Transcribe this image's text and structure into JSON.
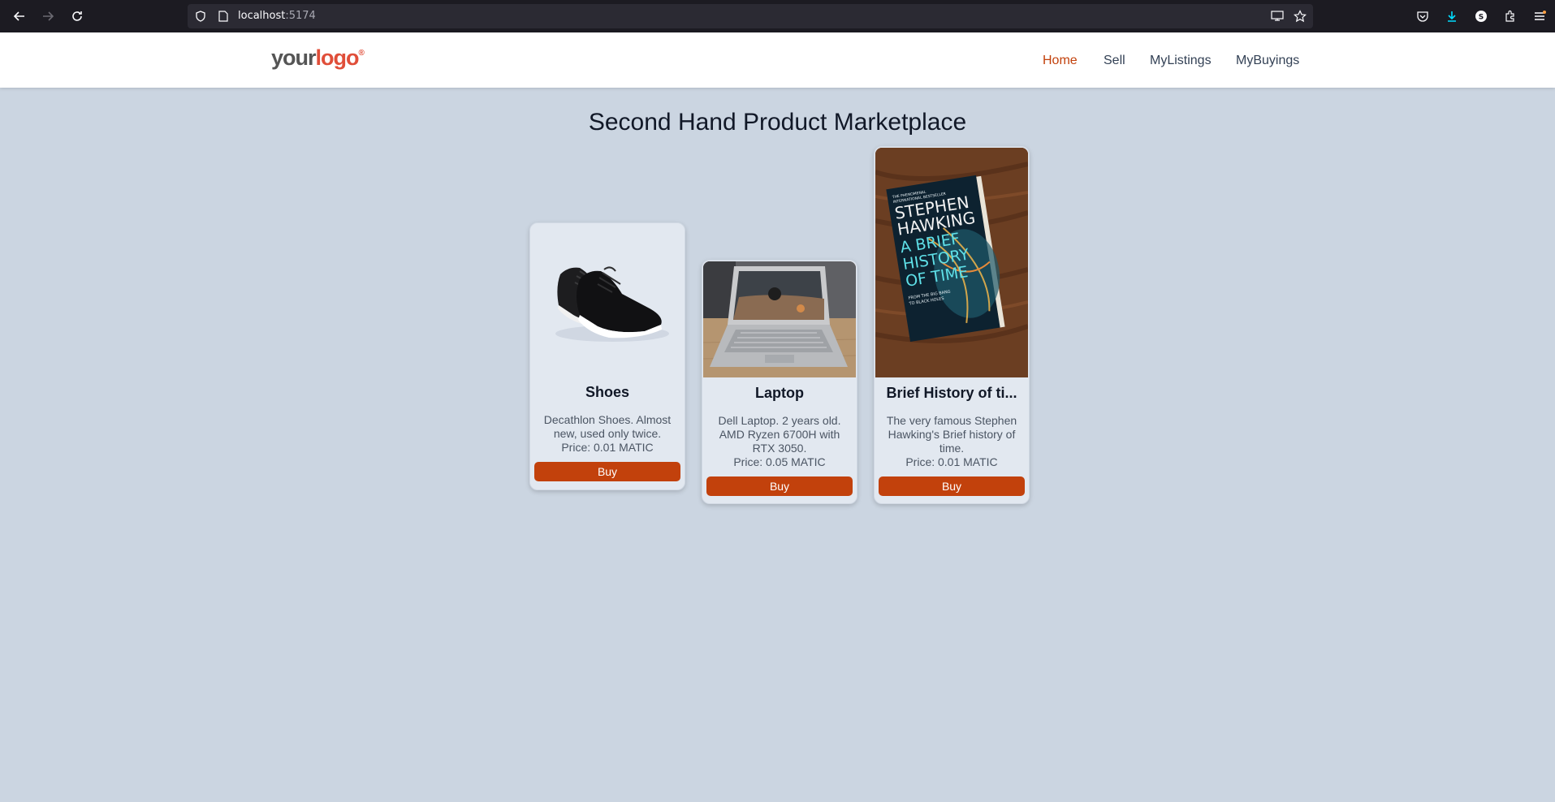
{
  "browser": {
    "url_host": "localhost",
    "url_port": ":5174"
  },
  "header": {
    "logo_your": "your",
    "logo_logo": "logo",
    "logo_mark": "®",
    "nav": [
      "Home",
      "Sell",
      "MyListings",
      "MyBuyings"
    ],
    "active_nav": "Home",
    "accent_color": "#c2410c"
  },
  "main": {
    "title": "Second Hand Product Marketplace",
    "products": [
      {
        "name": "Shoes",
        "description": "Decathlon Shoes. Almost new, used only twice.",
        "price": "Price: 0.01 MATIC",
        "buy_label": "Buy"
      },
      {
        "name": "Laptop",
        "description": "Dell Laptop. 2 years old. AMD Ryzen 6700H with RTX 3050.",
        "price": "Price: 0.05 MATIC",
        "buy_label": "Buy"
      },
      {
        "name": "Brief History of ti...",
        "description": "The very famous Stephen Hawking's Brief history of time.",
        "price": "Price: 0.01 MATIC",
        "buy_label": "Buy",
        "cover_text": [
          "THE PHENOMENAL",
          "INTERNATIONAL BESTSELLER",
          "STEPHEN",
          "HAWKING",
          "A BRIEF",
          "HISTORY",
          "OF TIME",
          "FROM THE BIG BANG",
          "TO BLACK HOLES"
        ]
      }
    ]
  }
}
